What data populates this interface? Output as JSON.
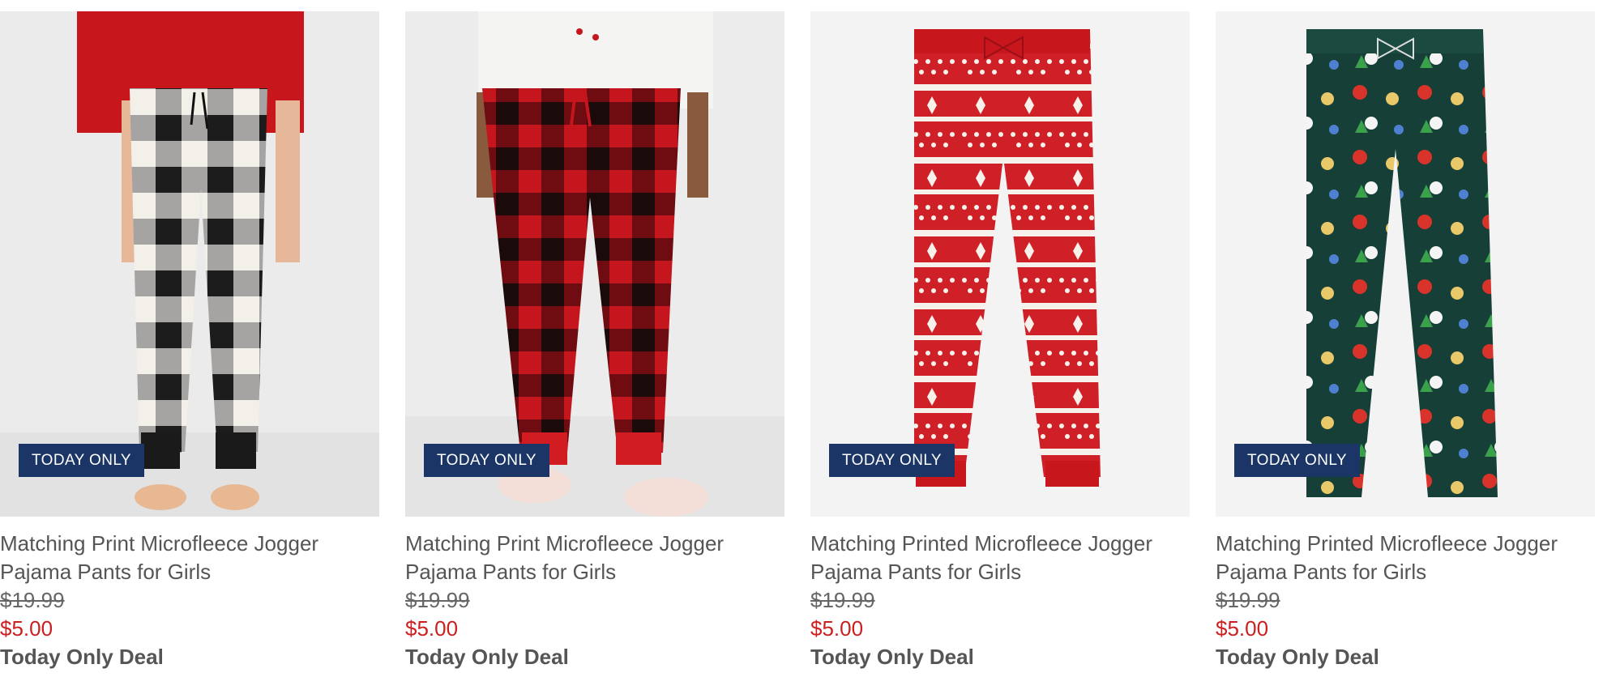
{
  "products": [
    {
      "badge": "TODAY ONLY",
      "name_line1": "Matching Print Microfleece Jogger",
      "name_line2": "Pajama Pants for Girls",
      "original_price": "$19.99",
      "sale_price": "$5.00",
      "deal_label": "Today Only Deal",
      "pattern": "black-white-buffalo-check"
    },
    {
      "badge": "TODAY ONLY",
      "name_line1": "Matching Print Microfleece Jogger",
      "name_line2": "Pajama Pants for Girls",
      "original_price": "$19.99",
      "sale_price": "$5.00",
      "deal_label": "Today Only Deal",
      "pattern": "red-black-buffalo-check"
    },
    {
      "badge": "TODAY ONLY",
      "name_line1": "Matching Printed Microfleece Jogger",
      "name_line2": "Pajama Pants for Girls",
      "original_price": "$19.99",
      "sale_price": "$5.00",
      "deal_label": "Today Only Deal",
      "pattern": "red-fair-isle"
    },
    {
      "badge": "TODAY ONLY",
      "name_line1": "Matching Printed Microfleece Jogger",
      "name_line2": "Pajama Pants for Girls",
      "original_price": "$19.99",
      "sale_price": "$5.00",
      "deal_label": "Today Only Deal",
      "pattern": "green-ornament-print"
    }
  ],
  "colors": {
    "badge_bg": "#1a3566",
    "sale_price": "#cc1f1f",
    "text": "#555555"
  }
}
